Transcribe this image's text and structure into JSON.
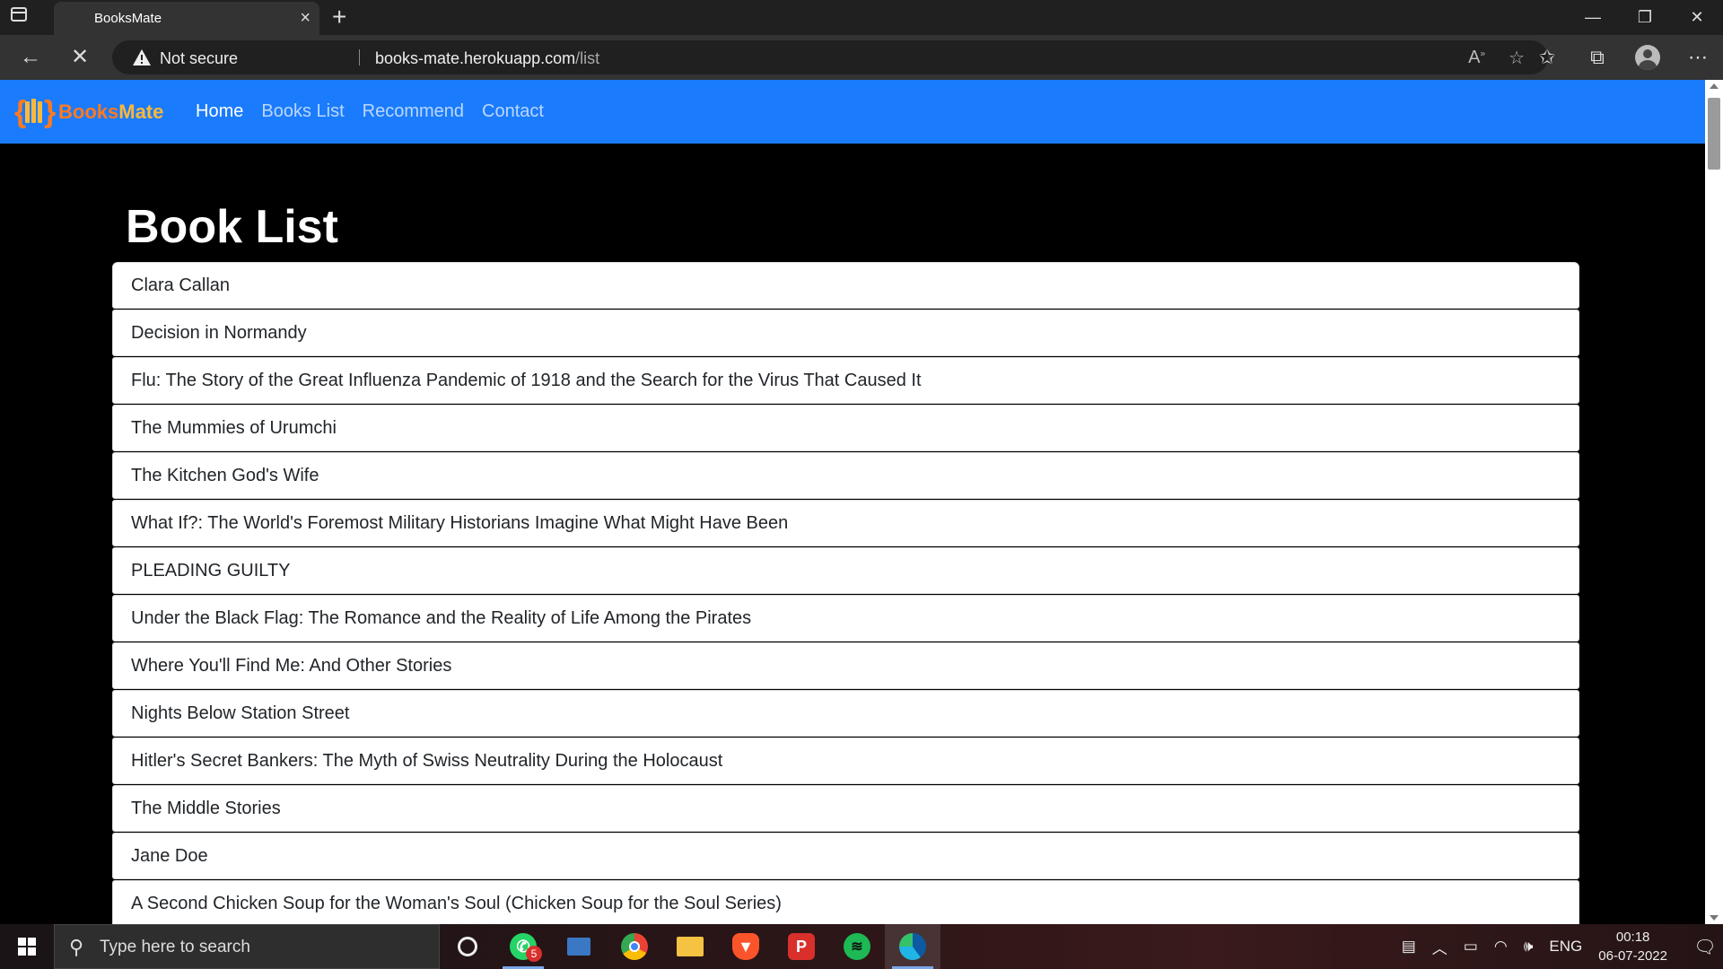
{
  "browser": {
    "tab_title": "BooksMate",
    "tab_close": "×",
    "new_tab": "+",
    "security_label": "Not secure",
    "url_host": "books-mate.herokuapp.com",
    "url_path": "/list",
    "win_minimize": "—",
    "win_restore": "❐",
    "win_close": "✕",
    "back": "←",
    "stop": "✕"
  },
  "site": {
    "brand_left": "Books",
    "brand_right": "Mate",
    "nav": [
      {
        "label": "Home",
        "active": true
      },
      {
        "label": "Books List",
        "active": false
      },
      {
        "label": "Recommend",
        "active": false
      },
      {
        "label": "Contact",
        "active": false
      }
    ],
    "heading": "Book List",
    "books": [
      "Clara Callan",
      "Decision in Normandy",
      "Flu: The Story of the Great Influenza Pandemic of 1918 and the Search for the Virus That Caused It",
      "The Mummies of Urumchi",
      "The Kitchen God's Wife",
      "What If?: The World's Foremost Military Historians Imagine What Might Have Been",
      "PLEADING GUILTY",
      "Under the Black Flag: The Romance and the Reality of Life Among the Pirates",
      "Where You'll Find Me: And Other Stories",
      "Nights Below Station Street",
      "Hitler's Secret Bankers: The Myth of Swiss Neutrality During the Holocaust",
      "The Middle Stories",
      "Jane Doe",
      "A Second Chicken Soup for the Woman's Soul (Chicken Soup for the Soul Series)",
      ""
    ]
  },
  "taskbar": {
    "search_placeholder": "Type here to search",
    "whatsapp_badge": "5",
    "language": "ENG",
    "time": "00:18",
    "date": "06-07-2022"
  },
  "colors": {
    "nav_bg": "#1a7bfc",
    "brand_orange": "#ff7a1f",
    "brand_yellow": "#ffb83a",
    "page_bg": "#000000"
  },
  "icons": {
    "browser": [
      "tab-actions-icon",
      "warning-icon",
      "read-aloud-icon",
      "add-favorite-icon",
      "favorites-icon",
      "collections-icon",
      "profile-icon",
      "more-icon"
    ],
    "taskbar": [
      "windows-start-icon",
      "search-icon",
      "cortana-icon",
      "whatsapp-icon",
      "desktop-app-icon",
      "chrome-icon",
      "file-explorer-icon",
      "brave-icon",
      "postman-icon",
      "spotify-icon",
      "edge-icon"
    ]
  }
}
